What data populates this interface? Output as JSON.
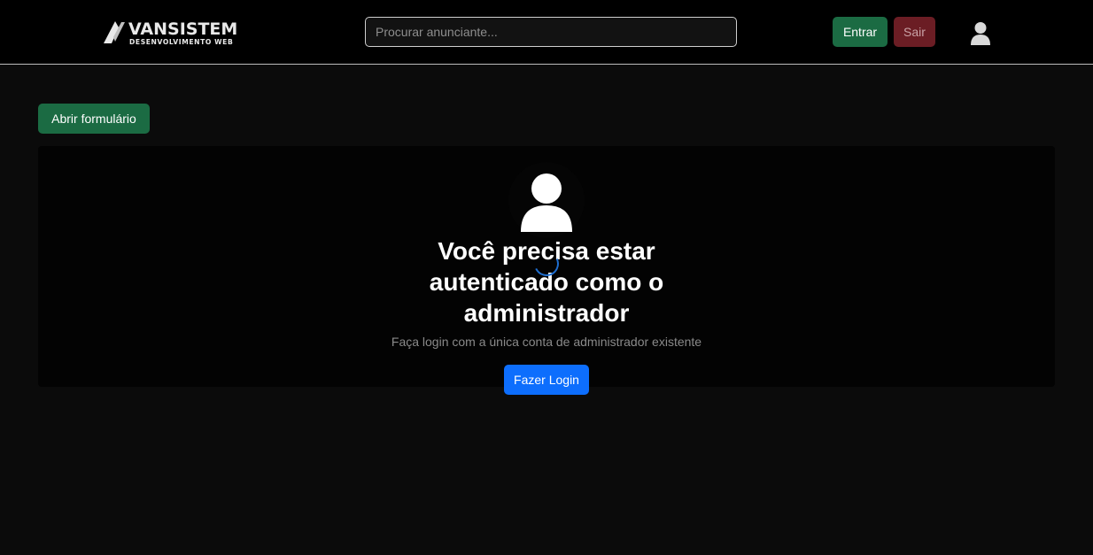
{
  "brand": {
    "name": "VANSISTEM",
    "tagline": "DESENVOLVIMENTO WEB"
  },
  "header": {
    "search": {
      "placeholder": "Procurar anunciante...",
      "value": ""
    },
    "login_label": "Entrar",
    "logout_label": "Sair",
    "user_icon": "user-icon"
  },
  "main": {
    "open_form_label": "Abrir formulário",
    "auth_card": {
      "avatar_icon": "user-avatar-icon",
      "title": "Você precisa estar autenticado como o administrador",
      "subtitle": "Faça login com a única conta de administrador existente",
      "login_button_label": "Fazer Login"
    }
  },
  "colors": {
    "background": "#0b0b0b",
    "navbar": "#000000",
    "success": "#1b6b43",
    "danger": "#6b1d24",
    "primary": "#0d6efd",
    "spinner": "#1f6fd1"
  }
}
